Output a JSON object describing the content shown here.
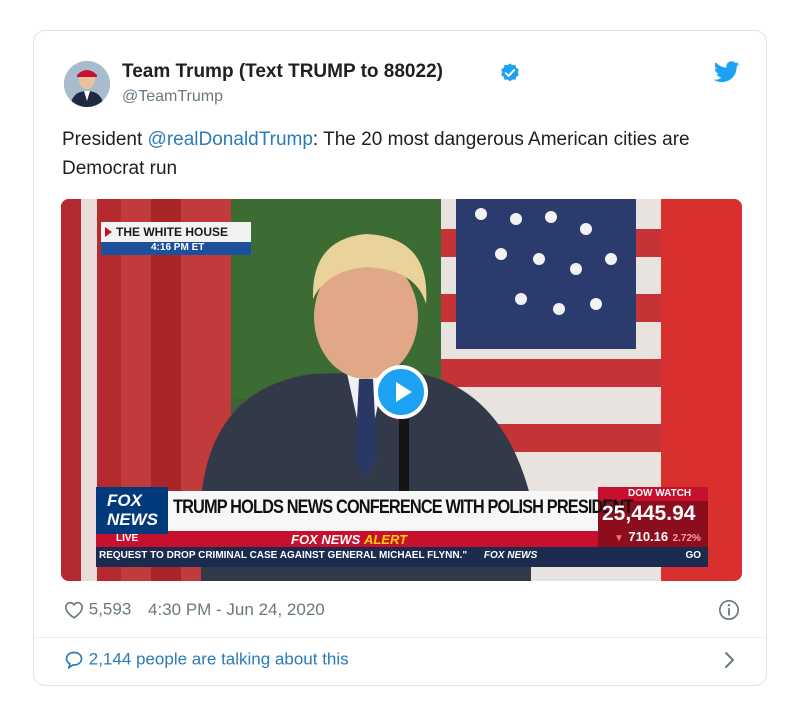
{
  "tweet": {
    "display_name": "Team Trump (Text TRUMP to 88022)",
    "handle": "@TeamTrump",
    "text_prefix": "President ",
    "mention": "@realDonaldTrump",
    "text_suffix": ": The 20 most dangerous American cities are Democrat run",
    "likes": "5,593",
    "timestamp": "4:30 PM - Jun 24, 2020",
    "talking": "2,144 people are talking about this"
  },
  "video": {
    "location_tag": "THE WHITE HOUSE",
    "time_tag": "4:16 PM ET",
    "network": "FOX",
    "network2": "NEWS",
    "live": "LIVE",
    "headline": "TRUMP HOLDS NEWS CONFERENCE WITH POLISH PRESIDENT",
    "alert_brand": "FOX NEWS",
    "alert_word": "ALERT",
    "ticker": "REQUEST TO DROP CRIMINAL CASE AGAINST GENERAL MICHAEL FLYNN.\"",
    "ticker_brand": "FOX NEWS",
    "ticker_tail": "GO",
    "dow_label": "DOW WATCH",
    "dow_value": "25,445.94",
    "dow_change": "710.16",
    "dow_pct": "2.72%"
  },
  "icons": {
    "verified": "verified-badge-icon",
    "twitter": "twitter-bird-icon",
    "heart": "heart-icon",
    "info": "info-icon",
    "comment": "comment-bubble-icon",
    "chevron": "chevron-right-icon",
    "play": "play-icon"
  },
  "colors": {
    "accent": "#1da1f2",
    "link": "#2b7bb9",
    "muted": "#697882",
    "fox_red": "#c8102e",
    "fox_blue": "#003366"
  }
}
